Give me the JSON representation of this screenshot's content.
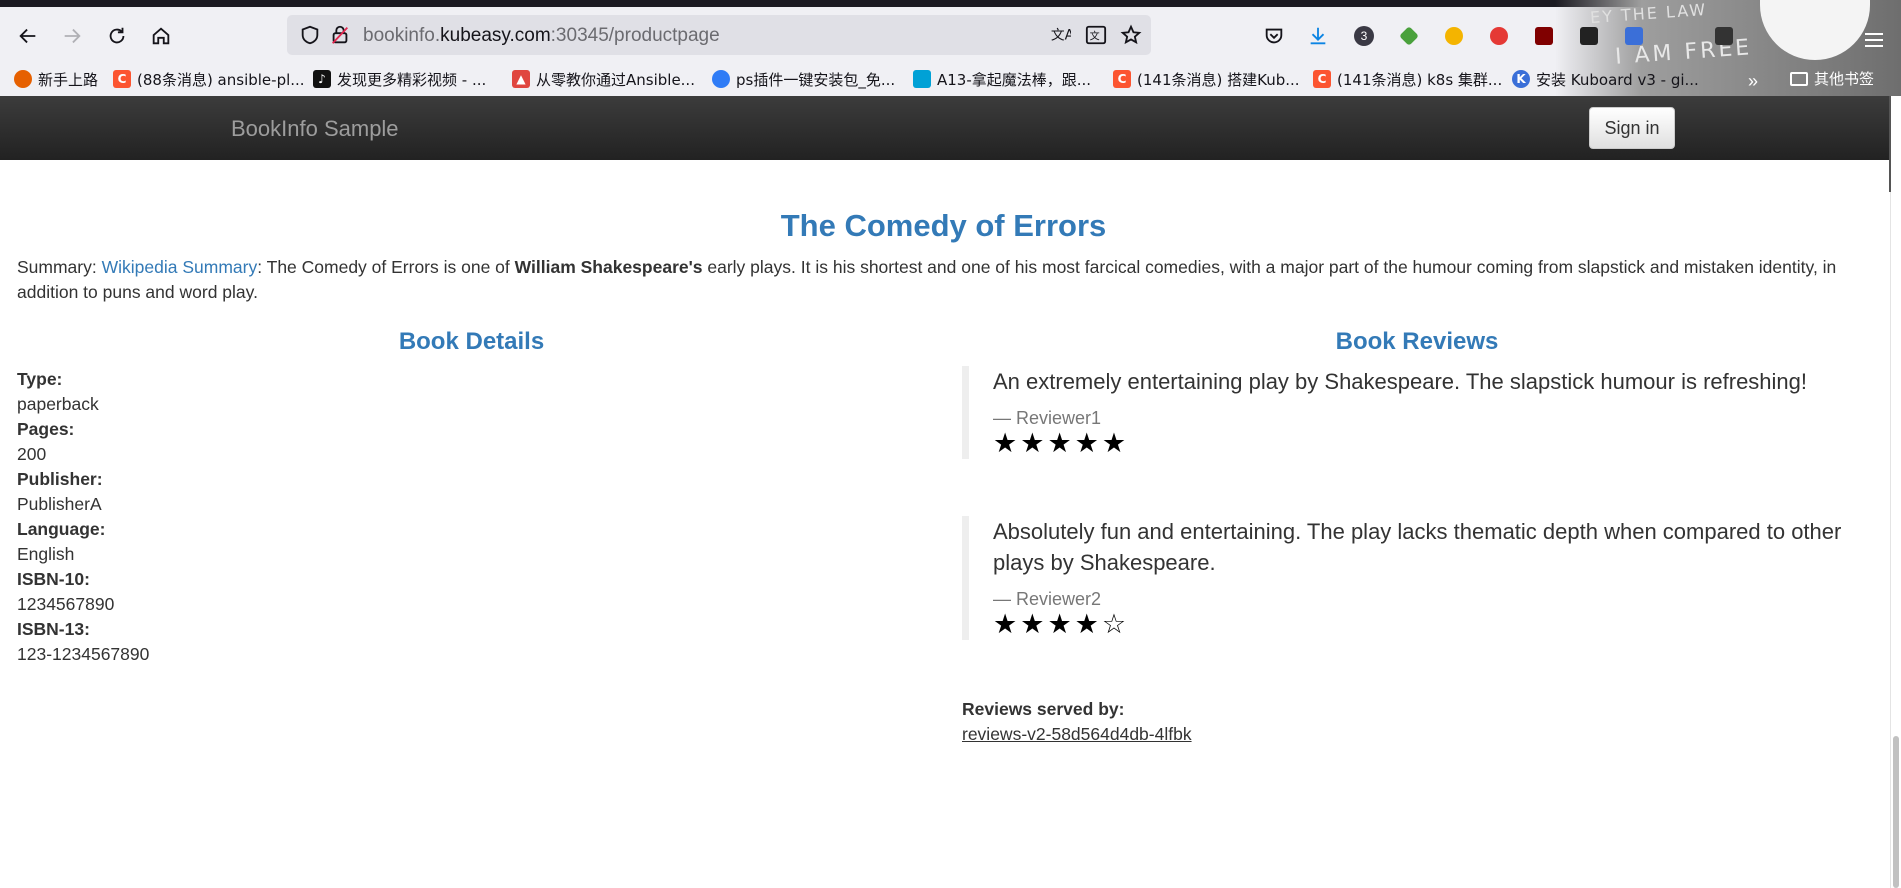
{
  "browser": {
    "url_prefix": "bookinfo.",
    "url_domain": "kubeasy.com",
    "url_suffix": ":30345/productpage",
    "download_count": "3",
    "theme_text_top": "EY THE LAW",
    "theme_text": "I AM FREE",
    "bookmarks": [
      {
        "label": "新手上路",
        "icon": "firefox-icon",
        "color": "#e66000"
      },
      {
        "label": "(88条消息) ansible-pl...",
        "icon": "csdn-icon",
        "color": "#fc5531"
      },
      {
        "label": "发现更多精彩视频 - ...",
        "icon": "tiktok-icon",
        "color": "#111111"
      },
      {
        "label": "从零教你通过Ansible...",
        "icon": "zhihu-icon",
        "color": "#e0463f"
      },
      {
        "label": "ps插件一键安装包_免...",
        "icon": "baidu-icon",
        "color": "#2f7cf6"
      },
      {
        "label": "A13-拿起魔法棒，跟...",
        "icon": "bilibili-icon",
        "color": "#00a1d6"
      },
      {
        "label": "(141条消息) 搭建Kub...",
        "icon": "csdn-icon",
        "color": "#fc5531"
      },
      {
        "label": "(141条消息) k8s 集群...",
        "icon": "csdn-icon",
        "color": "#fc5531"
      },
      {
        "label": "安装 Kuboard v3 - gi...",
        "icon": "kuboard-icon",
        "color": "#3a6fd8"
      }
    ],
    "bookmarks_more": "»",
    "other_bookmarks": "其他书签"
  },
  "navbar": {
    "brand": "BookInfo Sample",
    "sign_in": "Sign in"
  },
  "book": {
    "title": "The Comedy of Errors",
    "summary_label": "Summary: ",
    "summary_link": "Wikipedia Summary",
    "summary_part1": ": The Comedy of Errors is one of ",
    "summary_bold": "William Shakespeare's",
    "summary_part2": " early plays. It is his shortest and one of his most farcical comedies, with a major part of the humour coming from slapstick and mistaken identity, in addition to puns and word play."
  },
  "details": {
    "heading": "Book Details",
    "items": [
      {
        "label": "Type:",
        "value": "paperback"
      },
      {
        "label": "Pages:",
        "value": "200"
      },
      {
        "label": "Publisher:",
        "value": "PublisherA"
      },
      {
        "label": "Language:",
        "value": "English"
      },
      {
        "label": "ISBN-10:",
        "value": "1234567890"
      },
      {
        "label": "ISBN-13:",
        "value": "123-1234567890"
      }
    ]
  },
  "reviews": {
    "heading": "Book Reviews",
    "items": [
      {
        "text": "An extremely entertaining play by Shakespeare. The slapstick humour is refreshing!",
        "reviewer": "— Reviewer1",
        "rating": 5
      },
      {
        "text": "Absolutely fun and entertaining. The play lacks thematic depth when compared to other plays by Shakespeare.",
        "reviewer": "— Reviewer2",
        "rating": 4
      }
    ],
    "served_label": "Reviews served by:",
    "served_by": "reviews-v2-58d564d4db-4lfbk"
  }
}
